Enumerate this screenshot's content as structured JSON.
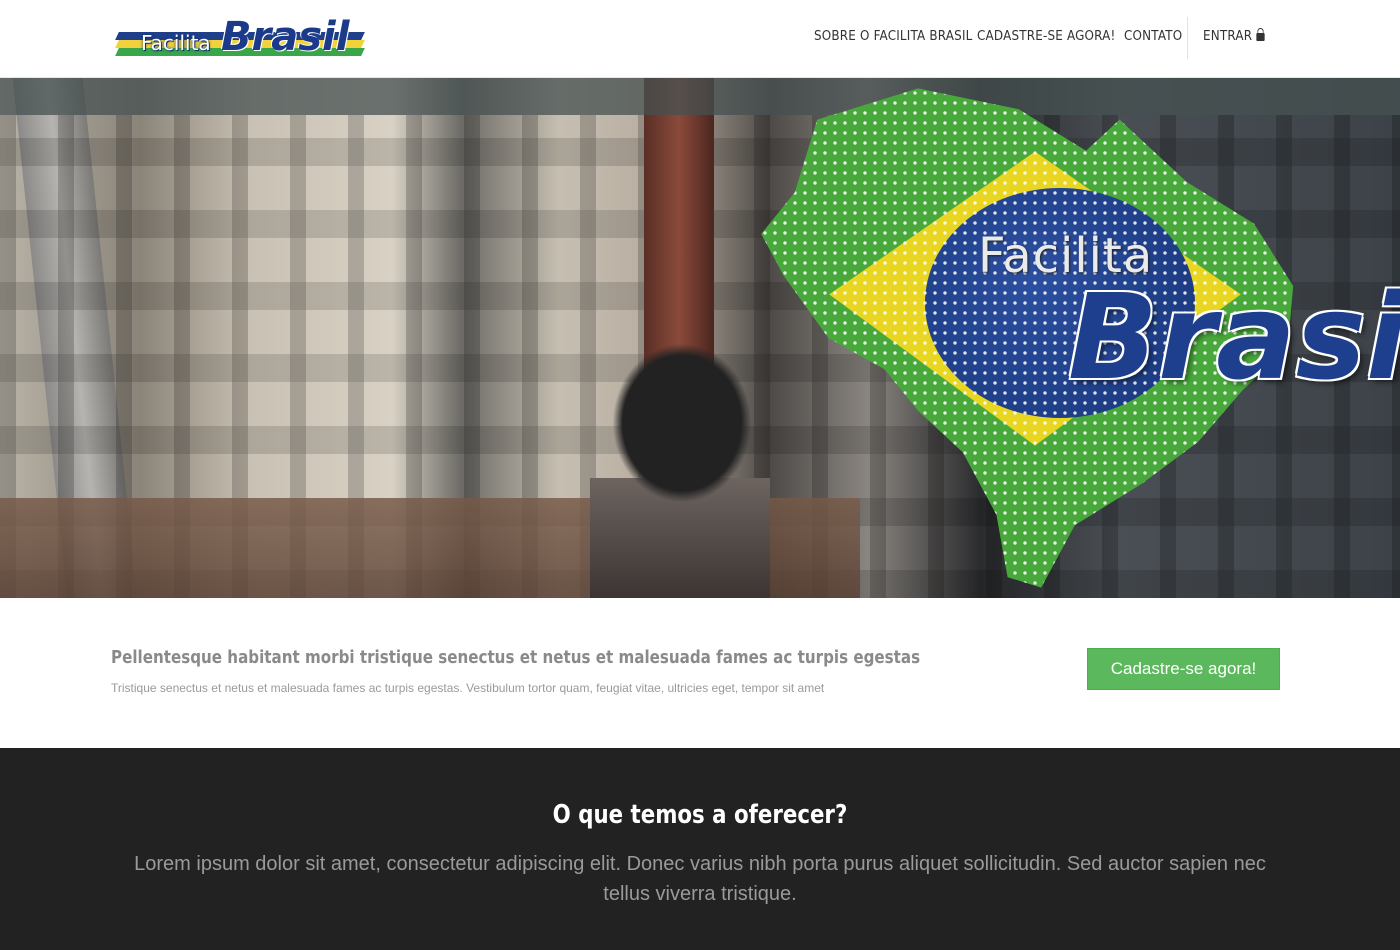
{
  "header": {
    "logo": {
      "small": "Facilita",
      "big": "Brasil"
    },
    "nav": [
      {
        "label": "SOBRE O FACILITA BRASIL"
      },
      {
        "label": "CADASTRE-SE AGORA!"
      },
      {
        "label": "CONTATO"
      },
      {
        "label": "ENTRAR",
        "icon": "lock-icon"
      }
    ]
  },
  "hero": {
    "small": "Facilita",
    "big": "Brasil"
  },
  "cta": {
    "title": "Pellentesque habitant morbi tristique senectus et netus et malesuada fames ac turpis egestas",
    "subtitle": "Tristique senectus et netus et malesuada fames ac turpis egestas. Vestibulum tortor quam, feugiat vitae, ultricies eget, tempor sit amet",
    "button": "Cadastre-se agora!"
  },
  "offer": {
    "title": "O que temos a oferecer?",
    "text": "Lorem ipsum dolor sit amet, consectetur adipiscing elit. Donec varius nibh porta purus aliquet sollicitudin. Sed auctor sapien nec tellus viverra tristique."
  },
  "colors": {
    "accent_green": "#5cb85c",
    "brand_blue": "#1e3f8d",
    "dark_bg": "#222222"
  }
}
